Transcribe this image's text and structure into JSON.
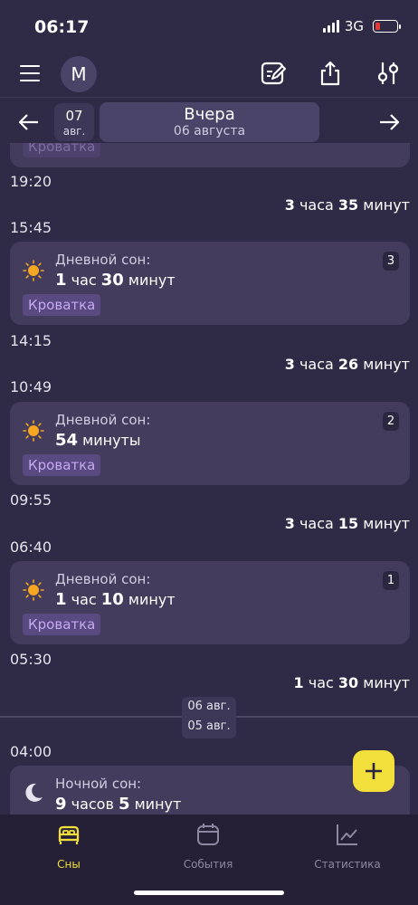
{
  "status": {
    "time": "06:17",
    "network": "3G"
  },
  "header": {
    "avatar_letter": "M"
  },
  "date_nav": {
    "prev_day": "07",
    "prev_month": "авг.",
    "title": "Вчера",
    "subtitle": "06 августа"
  },
  "timeline": {
    "top_tag": "Кроватка",
    "t1": "19:20",
    "gap1": {
      "a": "3",
      "b": " часа ",
      "c": "35",
      "d": " минут"
    },
    "t2": "15:45",
    "card1": {
      "title": "Дневной сон:",
      "num1": "1",
      "unit1": " час ",
      "num2": "30",
      "unit2": " минут",
      "tag": "Кроватка",
      "badge": "3"
    },
    "t3": "14:15",
    "gap2": {
      "a": "3",
      "b": " часа ",
      "c": "26",
      "d": " минут"
    },
    "t4": "10:49",
    "card2": {
      "title": "Дневной сон:",
      "num1": "54",
      "unit1": " минуты",
      "tag": "Кроватка",
      "badge": "2"
    },
    "t5": "09:55",
    "gap3": {
      "a": "3",
      "b": " часа ",
      "c": "15",
      "d": " минут"
    },
    "t6": "06:40",
    "card3": {
      "title": "Дневной сон:",
      "num1": "1",
      "unit1": " час ",
      "num2": "10",
      "unit2": " минут",
      "tag": "Кроватка",
      "badge": "1"
    },
    "t7": "05:30",
    "gap4": {
      "a": "1",
      "b": " час ",
      "c": "30",
      "d": " минут"
    },
    "day_sep": {
      "upper": "06 авг.",
      "lower": "05 авг."
    },
    "t8": "04:00",
    "card4": {
      "title": "Ночной сон:",
      "num1": "9",
      "unit1": " часов ",
      "num2": "5",
      "unit2": " минут"
    }
  },
  "tabs": [
    {
      "label": "Сны",
      "active": true
    },
    {
      "label": "События",
      "active": false
    },
    {
      "label": "Статистика",
      "active": false
    }
  ],
  "colors": {
    "accent": "#f2df3b",
    "background": "#2f2a45",
    "card": "#433c5d",
    "tag_text": "#c7a9f1"
  }
}
